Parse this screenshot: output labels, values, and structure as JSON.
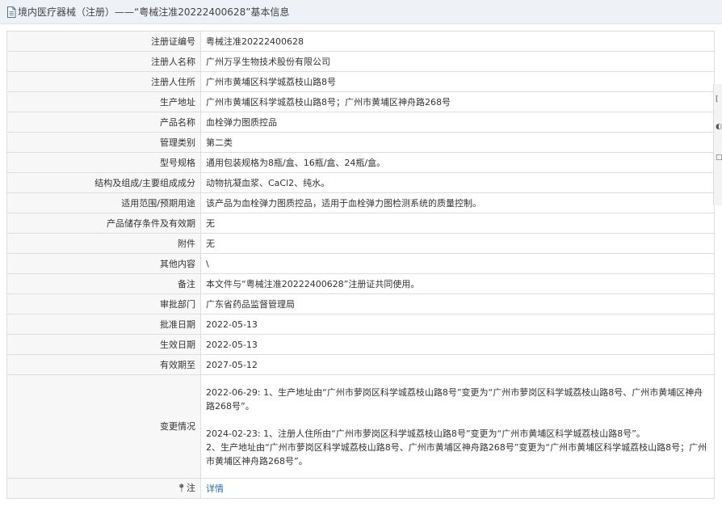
{
  "header": {
    "title": "境内医疗器械（注册）——“粤械注准20222400628”基本信息"
  },
  "rows": [
    {
      "label": "注册证编号",
      "value": "粤械注准20222400628"
    },
    {
      "label": "注册人名称",
      "value": "广州万孚生物技术股份有限公司"
    },
    {
      "label": "注册人住所",
      "value": "广州市黄埔区科学城荔枝山路8号"
    },
    {
      "label": "生产地址",
      "value": "广州市黄埔区科学城荔枝山路8号；广州市黄埔区神舟路268号"
    },
    {
      "label": "产品名称",
      "value": "血栓弹力图质控品"
    },
    {
      "label": "管理类别",
      "value": "第二类"
    },
    {
      "label": "型号规格",
      "value": "通用包装规格为8瓶/盒、16瓶/盒、24瓶/盒。"
    },
    {
      "label": "结构及组成/主要组成成分",
      "value": "动物抗凝血浆、CaCl2、纯水。"
    },
    {
      "label": "适用范围/预期用途",
      "value": "该产品为血栓弹力图质控品，适用于血栓弹力图检测系统的质量控制。"
    },
    {
      "label": "产品储存条件及有效期",
      "value": "无"
    },
    {
      "label": "附件",
      "value": "无"
    },
    {
      "label": "其他内容",
      "value": "\\"
    },
    {
      "label": "备注",
      "value": "本文件与“粤械注准20222400628”注册证共同使用。"
    },
    {
      "label": "审批部门",
      "value": "广东省药品监督管理局"
    },
    {
      "label": "批准日期",
      "value": "2022-05-13"
    },
    {
      "label": "生效日期",
      "value": "2022-05-13"
    },
    {
      "label": "有效期至",
      "value": "2027-05-12"
    }
  ],
  "changes": {
    "label": "变更情况",
    "entry1": "2022-06-29: 1、生产地址由“广州市萝岗区科学城荔枝山路8号”变更为“广州市萝岗区科学城荔枝山路8号、广州市黄埔区神舟路268号”。",
    "entry2_line1": "2024-02-23: 1、注册人住所由“广州市萝岗区科学城荔枝山路8号”变更为“广州市黄埔区科学城荔枝山路8号”。",
    "entry2_line2": "2、生产地址由“广州市萝岗区科学城荔枝山路8号、广州市黄埔区神舟路268号”变更为“广州市黄埔区科学城荔枝山路8号；广州市黄埔区神舟路268号”。"
  },
  "note": {
    "label": "注",
    "link": "详情"
  }
}
